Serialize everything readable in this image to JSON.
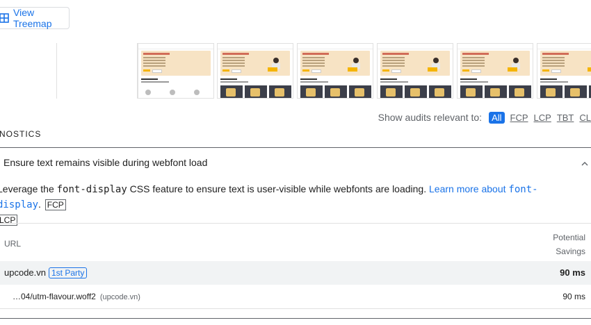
{
  "treemap": {
    "label": "View Treemap",
    "icon": "treemap-icon"
  },
  "filter": {
    "label": "Show audits relevant to:",
    "chips": [
      "All",
      "FCP",
      "LCP",
      "TBT",
      "CL"
    ]
  },
  "section": {
    "title": "NOSTICS"
  },
  "audit": {
    "title": "Ensure text remains visible during webfont load",
    "desc_prefix": "Leverage the ",
    "desc_code": "font-display",
    "desc_mid": " CSS feature to ensure text is user-visible while webfonts are loading. ",
    "link_text": "Learn more about ",
    "link_code": "font-display",
    "period": ".",
    "tags": [
      "FCP",
      "LCP"
    ]
  },
  "table": {
    "col_url": "URL",
    "col_savings_1": "Potential",
    "col_savings_2": "Savings",
    "rows": [
      {
        "host": "upcode.vn",
        "party": "1st Party",
        "savings": "90 ms"
      },
      {
        "file": "…04/utm-flavour.woff2",
        "origin": "(upcode.vn)",
        "savings": "90 ms"
      }
    ]
  },
  "colors": {
    "accent": "#1a73e8",
    "row_bg": "#f1f3f4",
    "hero_bg": "#f7e3c4"
  }
}
